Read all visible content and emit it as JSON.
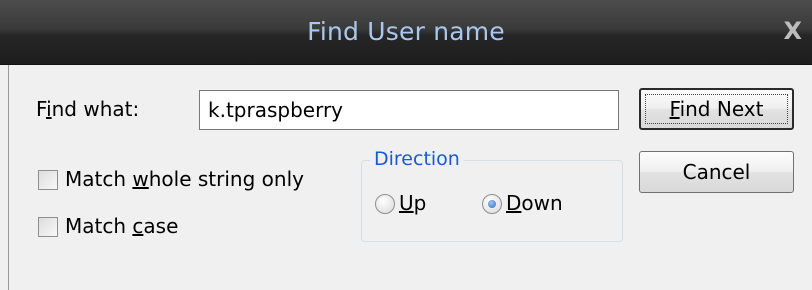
{
  "window": {
    "title": "Find User name",
    "close_glyph": "X"
  },
  "find": {
    "label": "Find what:",
    "value": "k.tpraspberry"
  },
  "options": {
    "whole_string": {
      "label": "Match whole string only",
      "checked": false
    },
    "match_case": {
      "label": "Match case",
      "checked": false
    }
  },
  "direction": {
    "title": "Direction",
    "up_label": "Up",
    "down_label": "Down",
    "selected": "Down"
  },
  "buttons": {
    "find_next": "Find Next",
    "cancel": "Cancel"
  },
  "colors": {
    "title_text": "#a8c8ee",
    "group_title": "#1a5ad1"
  }
}
